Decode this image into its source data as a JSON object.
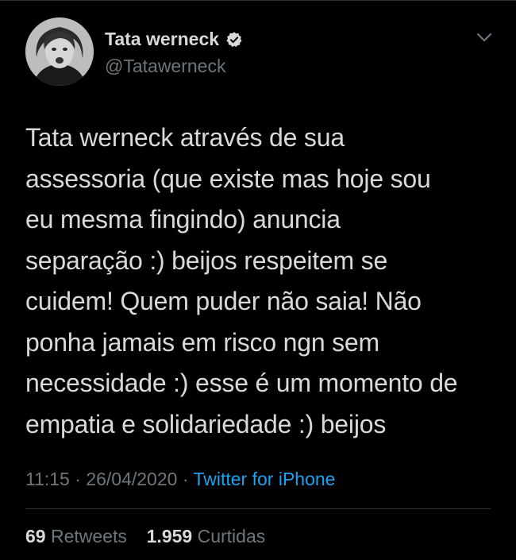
{
  "tweet": {
    "author": {
      "display_name": "Tata werneck",
      "handle": "@Tatawerneck",
      "verified": true,
      "avatar_icon": "profile-photo"
    },
    "text_lines": [
      "Tata werneck através de sua",
      "assessoria (que existe mas hoje sou",
      "eu mesma fingindo) anuncia",
      "separação :) beijos respeitem se",
      "cuidem! Quem puder não saia! Não",
      "ponha jamais em risco ngn sem",
      "necessidade :) esse é um momento de",
      "empatia e solidariedade :) beijos"
    ],
    "time": "11:15",
    "separator": "·",
    "date": "26/04/2020",
    "source": "Twitter for iPhone",
    "stats": {
      "retweets_count": "69",
      "retweets_label": "Retweets",
      "likes_count": "1.959",
      "likes_label": "Curtidas"
    }
  },
  "colors": {
    "background": "#000000",
    "text": "#d9d9d9",
    "secondary": "#6e767d",
    "link": "#1da1f2",
    "divider": "#2f3336"
  },
  "icons": {
    "verified": "verified-badge-icon",
    "menu": "chevron-down-icon"
  }
}
